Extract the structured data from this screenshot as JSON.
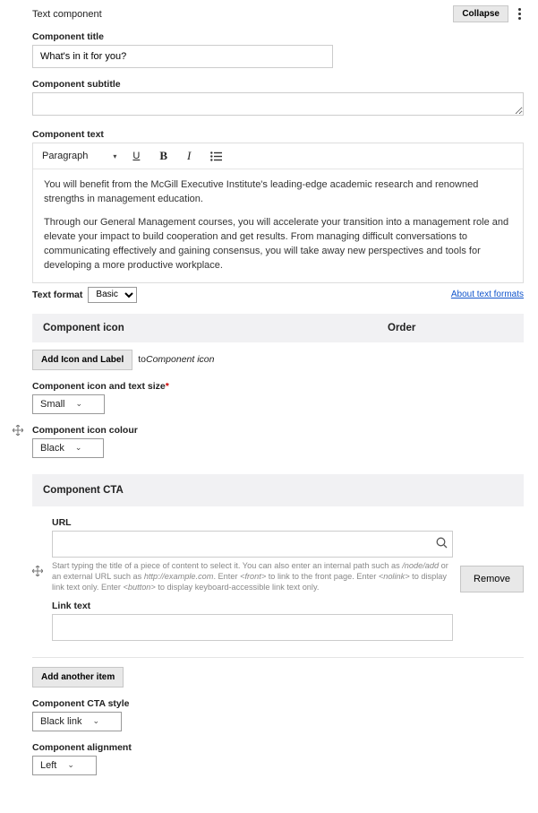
{
  "header": {
    "title": "Text component",
    "collapse": "Collapse"
  },
  "componentTitle": {
    "label": "Component title",
    "value": "What's in it for you?"
  },
  "componentSubtitle": {
    "label": "Component subtitle",
    "value": ""
  },
  "componentText": {
    "label": "Component text",
    "toolbarFormat": "Paragraph",
    "para1": "You will benefit from the McGill Executive Institute's leading-edge academic research and renowned strengths in management education.",
    "para2": "Through our General Management courses, you will accelerate your transition into a management role and elevate your impact to build cooperation and get results. From managing difficult conversations to communicating effectively and gaining consensus, you will take away new perspectives and tools for developing a more productive workplace."
  },
  "textFormat": {
    "label": "Text format",
    "value": "Basic",
    "aboutLink": "About text formats"
  },
  "iconBand": {
    "title": "Component icon",
    "orderLabel": "Order"
  },
  "addIcon": {
    "button": "Add Icon and Label",
    "toPrefix": "to",
    "toTarget": "Component icon"
  },
  "iconSize": {
    "label": "Component icon and text size",
    "value": "Small"
  },
  "iconColour": {
    "label": "Component icon colour",
    "value": "Black"
  },
  "ctaBand": "Component CTA",
  "cta": {
    "urlLabel": "URL",
    "urlValue": "",
    "help_p1": "Start typing the title of a piece of content to select it. You can also enter an internal path such as ",
    "help_node": "/node/add",
    "help_p2": " or an external URL such as ",
    "help_ext": "http://example.com",
    "help_p3": ". Enter ",
    "help_front": "<front>",
    "help_p4": " to link to the front page. Enter ",
    "help_nolink": "<nolink>",
    "help_p5": " to display link text only. Enter ",
    "help_button": "<button>",
    "help_p6": " to display keyboard-accessible link text only.",
    "linkTextLabel": "Link text",
    "linkTextValue": "",
    "remove": "Remove"
  },
  "addAnother": "Add another item",
  "ctaStyle": {
    "label": "Component CTA style",
    "value": "Black link"
  },
  "alignment": {
    "label": "Component alignment",
    "value": "Left"
  }
}
